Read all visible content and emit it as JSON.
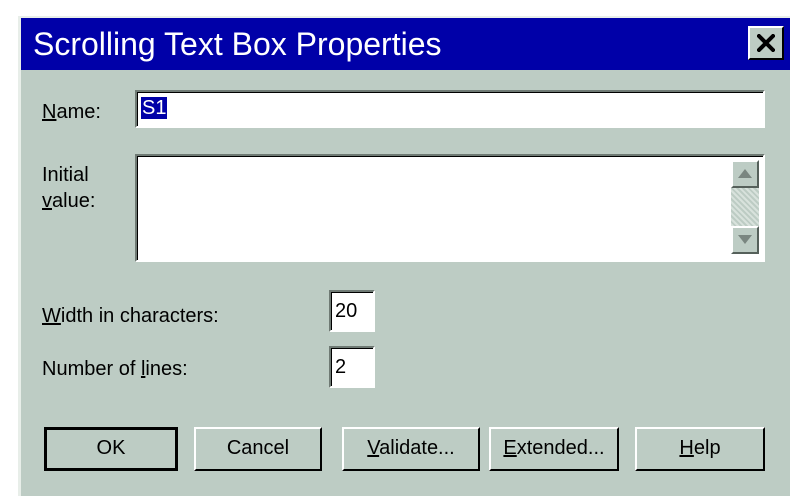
{
  "window": {
    "title": "Scrolling Text Box Properties"
  },
  "form": {
    "name_label": "Name:",
    "name_value": "S1",
    "initial_value_label_line1": "Initial",
    "initial_value_label_line2": "value:",
    "initial_value": "",
    "width_label": "Width in characters:",
    "width_value": "20",
    "lines_label": "Number of lines:",
    "lines_value": "2"
  },
  "buttons": {
    "ok": "OK",
    "cancel": "Cancel",
    "validate": "Validate...",
    "extended": "Extended...",
    "help": "Help"
  },
  "icons": {
    "close": "close-icon",
    "scroll_up": "arrow-up-icon",
    "scroll_down": "arrow-down-icon"
  },
  "colors": {
    "titlebar": "#0000a8",
    "dialog_bg": "#bdccc4",
    "selection": "#0000a8"
  }
}
